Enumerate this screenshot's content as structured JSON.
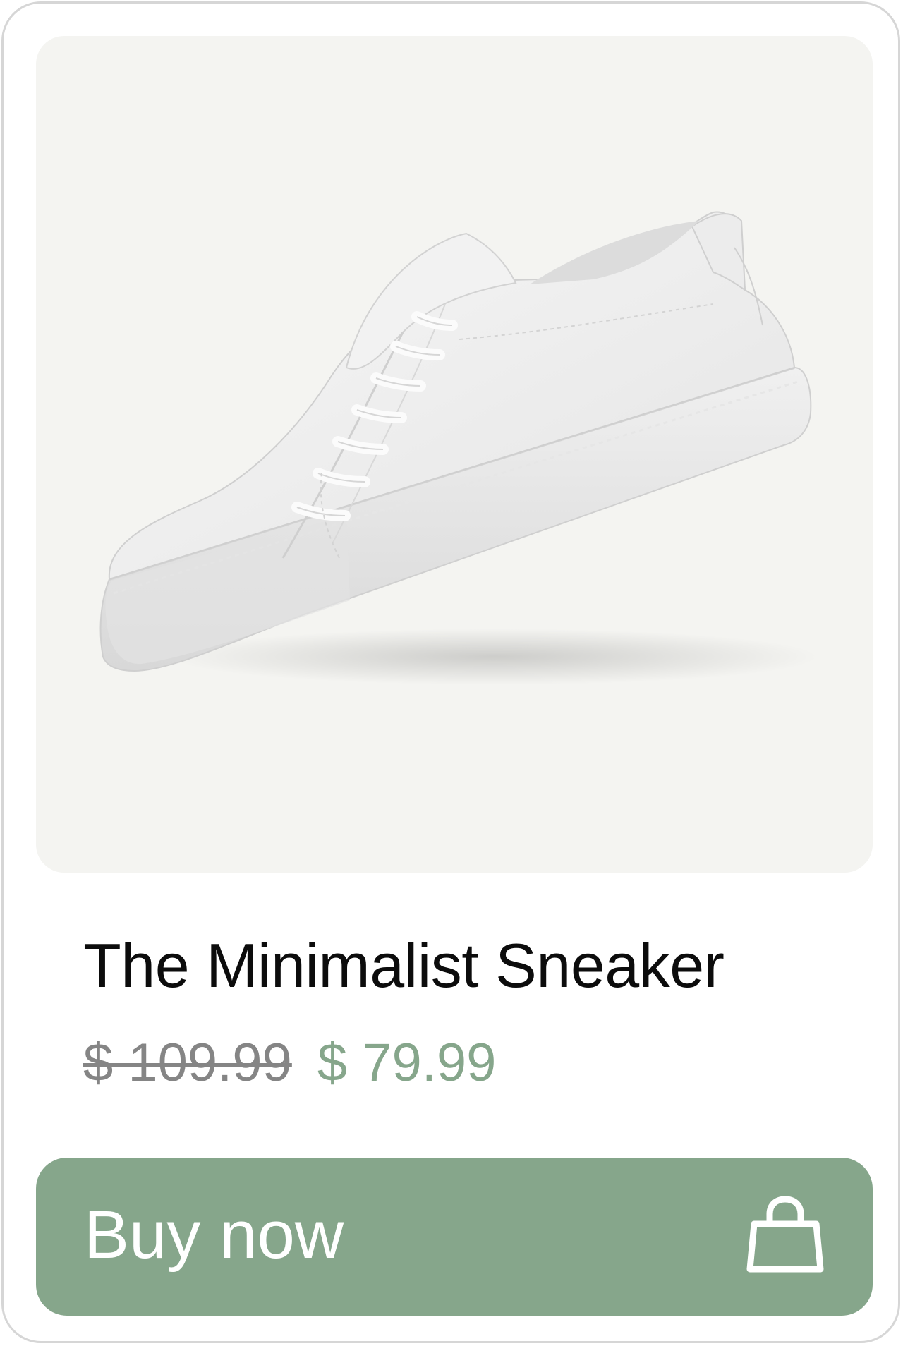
{
  "product": {
    "image_alt": "White minimalist leather sneaker",
    "name": "The Minimalist Sneaker",
    "original_price": "$ 109.99",
    "sale_price": "$ 79.99"
  },
  "actions": {
    "buy_label": "Buy now",
    "buy_icon": "shopping-bag-icon"
  },
  "colors": {
    "accent": "#86a68b",
    "strike_price": "#858585",
    "image_background": "#f4f4f1",
    "card_border": "#d6d6d6"
  }
}
